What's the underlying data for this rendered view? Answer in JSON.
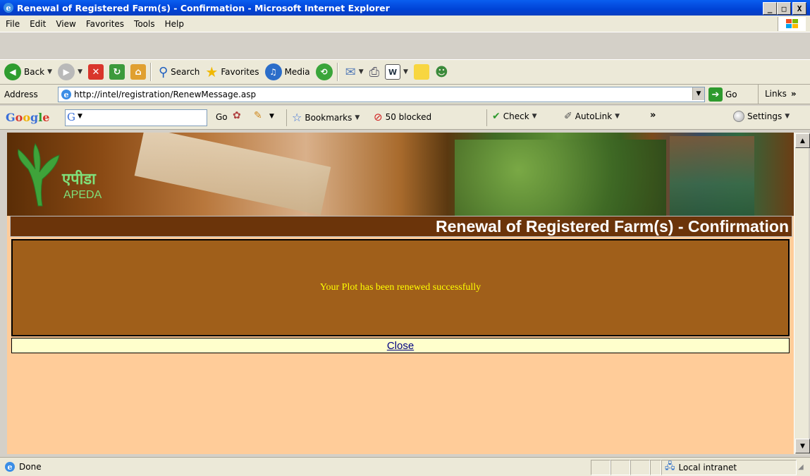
{
  "window": {
    "title": "Renewal of Registered Farm(s) - Confirmation - Microsoft Internet Explorer",
    "minimize": "_",
    "maximize": "□",
    "close": "X"
  },
  "menu": [
    "File",
    "Edit",
    "View",
    "Favorites",
    "Tools",
    "Help"
  ],
  "toolbar": {
    "back": "Back",
    "search": "Search",
    "favorites": "Favorites",
    "media": "Media"
  },
  "address": {
    "label": "Address",
    "url": "http://intel/registration/RenewMessage.asp",
    "go": "Go",
    "links": "Links"
  },
  "google": {
    "logo": "Google",
    "g_label": "G",
    "go": "Go",
    "bookmarks": "Bookmarks",
    "blocked": "50 blocked",
    "check": "Check",
    "autolink": "AutoLink",
    "settings": "Settings"
  },
  "page": {
    "logo_hindi": "एपीडा",
    "logo_english": "APEDA",
    "heading": "Renewal of Registered Farm(s) - Confirmation",
    "message": "Your Plot has been renewed successfully",
    "close_link": "Close"
  },
  "status": {
    "text": "Done",
    "zone": "Local intranet"
  },
  "colors": {
    "heading_bg": "#6b340a",
    "panel_bg": "#a05f1a",
    "message_text": "#ffff00",
    "close_row_bg": "#ffffcc",
    "page_bg": "#ffcc99"
  }
}
